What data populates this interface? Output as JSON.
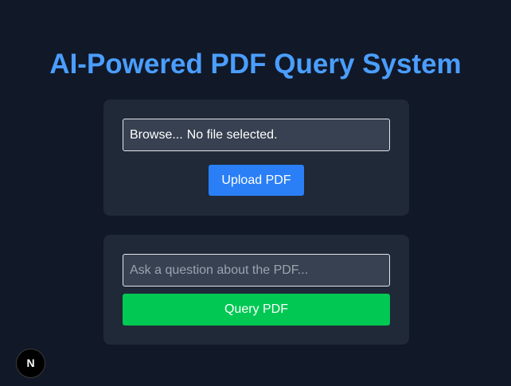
{
  "header": {
    "title": "AI-Powered PDF Query System"
  },
  "upload": {
    "browse_label": "Browse...",
    "file_status": "No file selected.",
    "upload_label": "Upload PDF"
  },
  "query": {
    "placeholder": "Ask a question about the PDF...",
    "value": "",
    "query_label": "Query PDF"
  },
  "dev_badge": {
    "letter": "N",
    "icon": "nextjs-logo-icon"
  },
  "colors": {
    "background": "#111827",
    "card": "#1f2937",
    "title": "#4a9eff",
    "upload_button": "#2a7ff6",
    "query_button": "#00c853"
  }
}
